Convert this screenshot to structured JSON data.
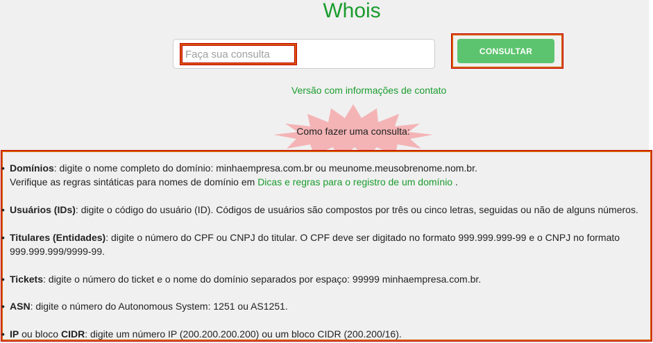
{
  "title": "Whois",
  "search": {
    "placeholder": "Faça sua consulta",
    "button_label": "CONSULTAR"
  },
  "contact_link": "Versão com informações de contato",
  "howto_label": "Como fazer uma consulta:",
  "colors": {
    "accent_green": "#1a9c2e",
    "button_green": "#5cc46e",
    "burst_pink": "#f4b4b6",
    "highlight_orange": "#d65a00"
  },
  "help": {
    "domains": {
      "term": "Domínios",
      "text": ": digite o nome completo do domínio: minhaempresa.com.br ou meunome.meusobrenome.nom.br.",
      "line2_pre": "Verifique as regras sintáticas para nomes de domínio em ",
      "line2_link": "Dicas e regras para o registro de um domínio",
      "line2_post": " ."
    },
    "users": {
      "term": "Usuários (IDs)",
      "text": ": digite o código do usuário (ID). Códigos de usuários são compostos por três ou cinco letras, seguidas ou não de alguns números."
    },
    "holders": {
      "term": "Titulares (Entidades)",
      "text": ": digite o número do CPF ou CNPJ do titular. O CPF deve ser digitado no formato 999.999.999-99 e o CNPJ no formato",
      "line2": "999.999.999/9999-99."
    },
    "tickets": {
      "term": "Tickets",
      "text": ": digite o número do ticket e o nome do domínio separados por espaço: 99999 minhaempresa.com.br."
    },
    "asn": {
      "term": "ASN",
      "text": ": digite o número do Autonomous System: 1251 ou AS1251."
    },
    "ip": {
      "term": "IP",
      "mid": " ou bloco ",
      "term2": "CIDR",
      "text": ": digite um número IP (200.200.200.200) ou um bloco CIDR (200.200/16)."
    }
  }
}
